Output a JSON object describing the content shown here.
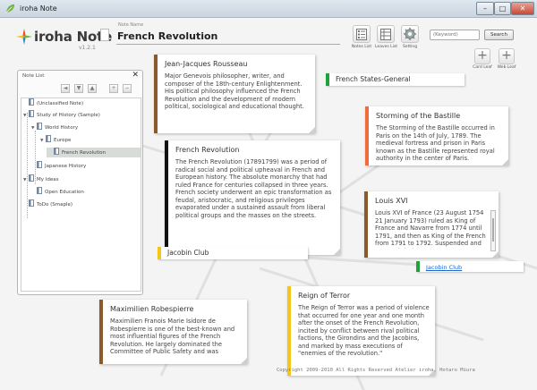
{
  "window": {
    "title": "iroha Note",
    "minimize": "–",
    "maximize": "□",
    "close": "✕"
  },
  "header": {
    "brand": "iroha Note",
    "version": "v1.2.1",
    "note_name_label": "Note Name",
    "note_name": "French Revolution",
    "tools": [
      {
        "label": "Notes List",
        "icon": "notes-list-icon"
      },
      {
        "label": "Leaves List",
        "icon": "leaves-list-icon"
      },
      {
        "label": "Setting",
        "icon": "gear-icon"
      }
    ],
    "search_placeholder": "(Keyword)",
    "search_button": "Search",
    "card_leaf": "Card Leaf",
    "web_leaf": "Web Leaf"
  },
  "note_list": {
    "title": "Note List",
    "close": "✕",
    "toolbar": [
      "◄",
      "▼",
      "▲",
      "+",
      "−"
    ],
    "items": [
      {
        "label": "(Unclassified Note)",
        "level": 0,
        "expander": ""
      },
      {
        "label": "Study of History (Sample)",
        "level": 0,
        "expander": "▼"
      },
      {
        "label": "World History",
        "level": 1,
        "expander": "▼"
      },
      {
        "label": "Europe",
        "level": 2,
        "expander": "▼"
      },
      {
        "label": "French Revolution",
        "level": 3,
        "expander": "",
        "selected": true
      },
      {
        "label": "Japanese History",
        "level": 1,
        "expander": ""
      },
      {
        "label": "My Ideas",
        "level": 0,
        "expander": "▼"
      },
      {
        "label": "Open Education",
        "level": 1,
        "expander": ""
      },
      {
        "label": "ToDo (Smaple)",
        "level": 0,
        "expander": ""
      }
    ]
  },
  "cards": {
    "rousseau": {
      "title": "Jean-Jacques Rousseau",
      "body": "Major Genevois philosopher, writer, and composer of the 18th-century Enlightenment. His political philosophy influenced the French Revolution and the development of modern political, sociological and educational thought.",
      "color": "#8B5A2B"
    },
    "bastille": {
      "title": "Storming of the Bastille",
      "body": "The Storming of the Bastille occurred in Paris on the 14th of July, 1789. The medieval fortress and prison in Paris known as the Bastille represented royal authority in the center of Paris.",
      "color": "#F26B3A"
    },
    "revolution": {
      "title": "French Revolution",
      "body": "The French Revolution (17891799) was a period of radical social and political upheaval in French and European history. The absolute monarchy that had ruled France for centuries collapsed in three years. French society underwent an epic transformation as feudal, aristocratic, and religious privileges evaporated under a sustained assault from liberal political groups and the masses on the streets.",
      "color": "#111111"
    },
    "louis": {
      "title": "Louis XVI",
      "body": "Louis XVI of France (23 August 1754 21 January 1793) ruled as King of France and Navarre from 1774 until 1791, and then as King of the French from 1791 to 1792. Suspended and arrested during",
      "color": "#8B5A2B"
    },
    "robespierre": {
      "title": "Maximilien Robespierre",
      "body": "Maximilien Franois Marie Isidore de Robespierre is one of the best-known and most influential figures of the French Revolution. He largely dominated the Committee of Public Safety and was",
      "color": "#8B5A2B"
    },
    "terror": {
      "title": "Reign of Terror",
      "body": "The Reign of Terror  was a period of violence that occurred for one year and one month after the onset of the French Revolution, incited by conflict between rival political factions, the Girondins and the Jacobins, and marked by mass executions of \"enemies of the revolution.\"",
      "color": "#F5C518"
    }
  },
  "labels": {
    "estates": {
      "text": "French States-General",
      "color": "#1FA23A"
    },
    "jacobin": {
      "text": "Jacobin Club",
      "color": "#F5C518"
    },
    "jacobin_link": {
      "text": "Jacobin Club",
      "color": "#1FA23A"
    }
  },
  "footer": {
    "copyright": "Copyright 2009-2010 All Rights Reserved Atelier iroha, Hotaro Miura"
  }
}
